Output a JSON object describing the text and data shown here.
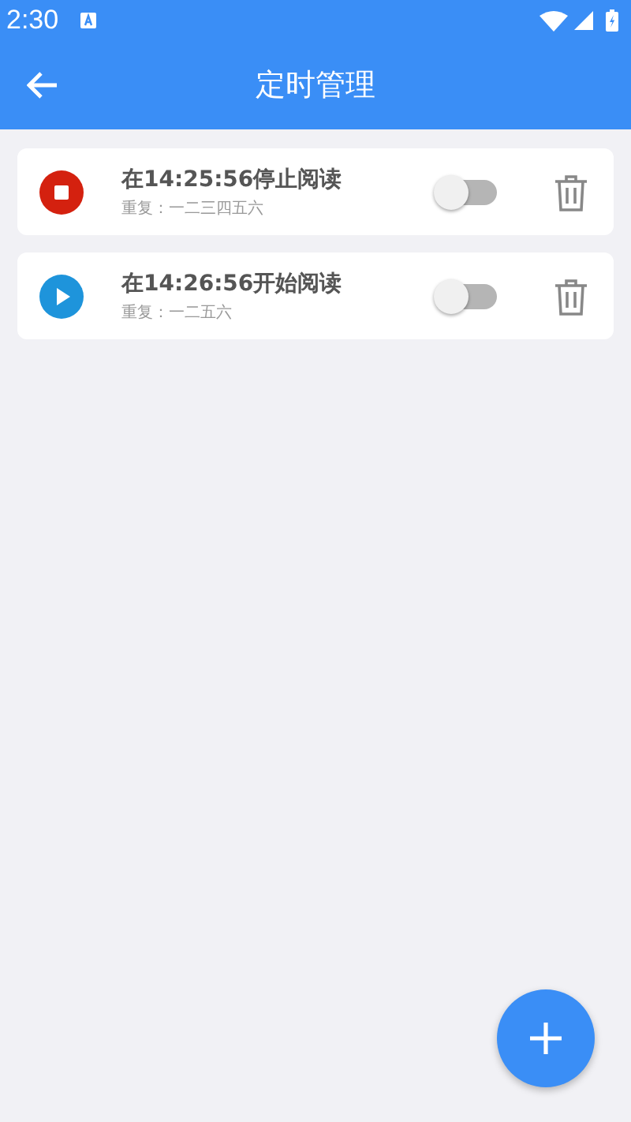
{
  "status_bar": {
    "time": "2:30"
  },
  "app_bar": {
    "title": "定时管理"
  },
  "timers": [
    {
      "kind": "stop",
      "title": "在14:25:56停止阅读",
      "repeat": "重复：一二三四五六",
      "on": false
    },
    {
      "kind": "start",
      "title": "在14:26:56开始阅读",
      "repeat": "重复：一二五六",
      "on": false
    }
  ]
}
